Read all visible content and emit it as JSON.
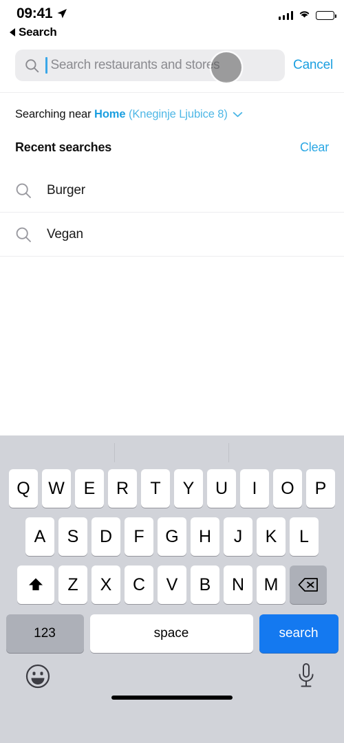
{
  "status_bar": {
    "time": "09:41",
    "location_icon": "location-arrow-icon",
    "signal_icon": "cellular-signal-icon",
    "wifi_icon": "wifi-icon",
    "battery_icon": "battery-full-icon"
  },
  "back": {
    "icon": "back-triangle-icon",
    "label": "Search"
  },
  "search": {
    "icon": "search-icon",
    "placeholder": "Search restaurants and stores",
    "value": "",
    "cancel_label": "Cancel"
  },
  "location": {
    "prefix": "Searching near ",
    "place": "Home",
    "address": "(Kneginje Ljubice 8)",
    "chevron_icon": "chevron-down-icon"
  },
  "recent": {
    "title": "Recent searches",
    "clear_label": "Clear",
    "items": [
      {
        "label": "Burger",
        "icon": "search-icon"
      },
      {
        "label": "Vegan",
        "icon": "search-icon"
      }
    ]
  },
  "keyboard": {
    "row1": [
      "Q",
      "W",
      "E",
      "R",
      "T",
      "Y",
      "U",
      "I",
      "O",
      "P"
    ],
    "row2": [
      "A",
      "S",
      "D",
      "F",
      "G",
      "H",
      "J",
      "K",
      "L"
    ],
    "row3": [
      "Z",
      "X",
      "C",
      "V",
      "B",
      "N",
      "M"
    ],
    "shift_icon": "shift-arrow-icon",
    "backspace_icon": "backspace-icon",
    "numbers_label": "123",
    "space_label": "space",
    "return_label": "search",
    "emoji_icon": "emoji-smiley-icon",
    "mic_icon": "microphone-icon"
  },
  "colors": {
    "accent_blue": "#1b9fe0",
    "key_blue": "#1479f0",
    "keyboard_bg": "#d1d3d9",
    "search_field_bg": "#ececee"
  }
}
